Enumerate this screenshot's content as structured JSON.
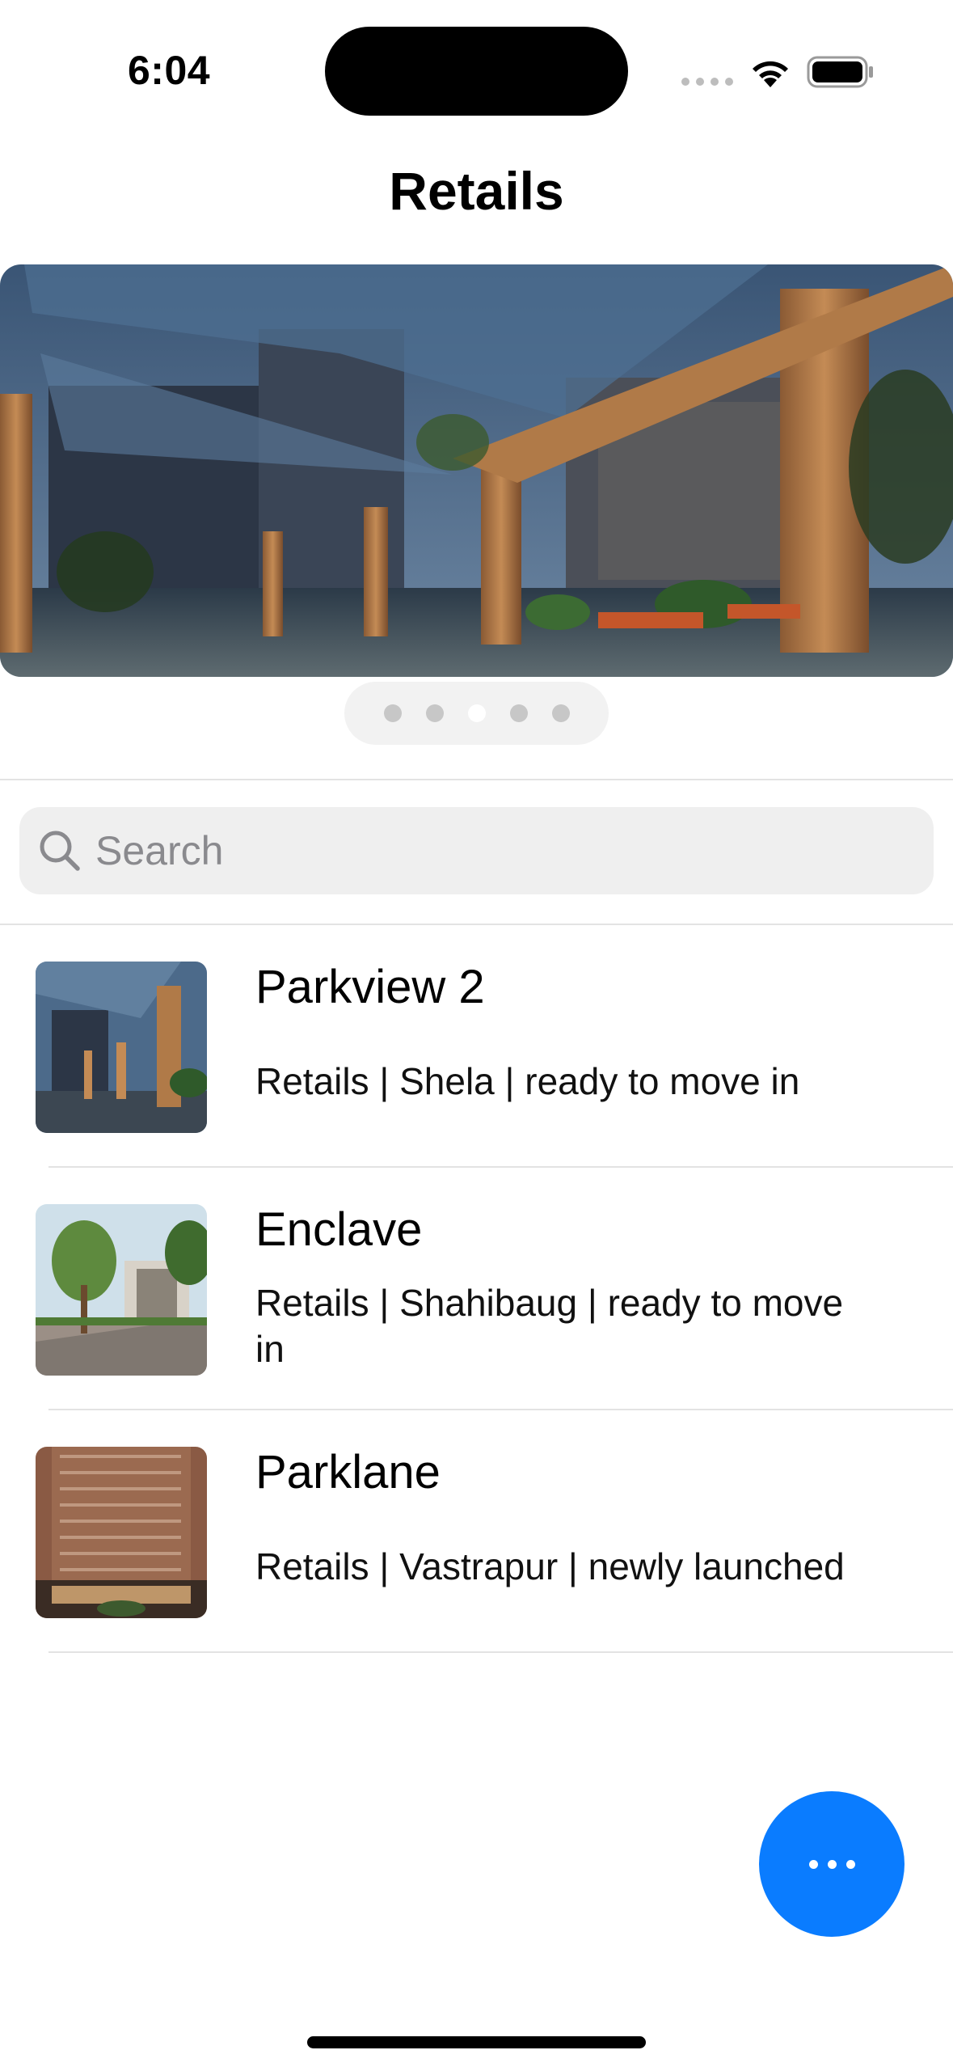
{
  "status_bar": {
    "time": "6:04"
  },
  "nav": {
    "title": "Retails"
  },
  "carousel": {
    "page_count": 5,
    "current_page": 3
  },
  "search": {
    "placeholder": "Search"
  },
  "list": {
    "items": [
      {
        "title": "Parkview 2",
        "subtitle": "Retails | Shela | ready to move in"
      },
      {
        "title": "Enclave",
        "subtitle": "Retails | Shahibaug | ready to move in"
      },
      {
        "title": "Parklane",
        "subtitle": "Retails | Vastrapur | newly launched"
      }
    ]
  },
  "fab": {
    "icon": "more-icon",
    "color": "#0A7CFF"
  }
}
